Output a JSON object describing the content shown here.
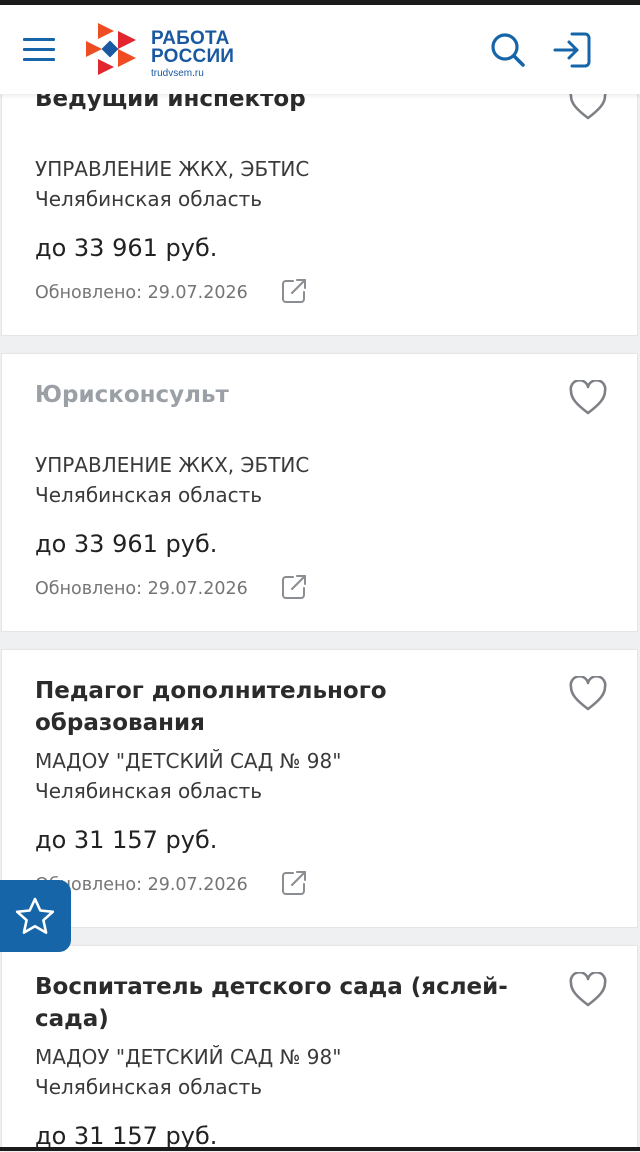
{
  "header": {
    "logo_line1": "РАБОТА",
    "logo_line2": "РОССИИ",
    "logo_domain": "trudvsem.ru",
    "menu_icon": "menu-icon",
    "search_icon": "search-icon",
    "login_icon": "login-icon"
  },
  "colors": {
    "brand_blue": "#1a59a1",
    "logo_orange": "#ee4c23",
    "logo_red": "#e2262f"
  },
  "vacancies": [
    {
      "title": "Ведущий инспектор",
      "company": "УПРАВЛЕНИЕ ЖКХ, ЭБТИС",
      "region": "Челябинская область",
      "salary": "до 33 961 руб.",
      "updated": "Обновлено: 29.07.2026"
    },
    {
      "title": "Юрисконсульт",
      "company": "УПРАВЛЕНИЕ ЖКХ, ЭБТИС",
      "region": "Челябинская область",
      "salary": "до 33 961 руб.",
      "updated": "Обновлено: 29.07.2026"
    },
    {
      "title": "Педагог дополнительного образования",
      "company": "МАДОУ \"ДЕТСКИЙ САД № 98\"",
      "region": "Челябинская область",
      "salary": "до 31 157 руб.",
      "updated": "Обновлено: 29.07.2026"
    },
    {
      "title": "Воспитатель детского сада (яслей-сада)",
      "company": "МАДОУ \"ДЕТСКИЙ САД № 98\"",
      "region": "Челябинская область",
      "salary": "до 31 157 руб."
    }
  ],
  "floating_button": {
    "icon": "star-icon"
  }
}
